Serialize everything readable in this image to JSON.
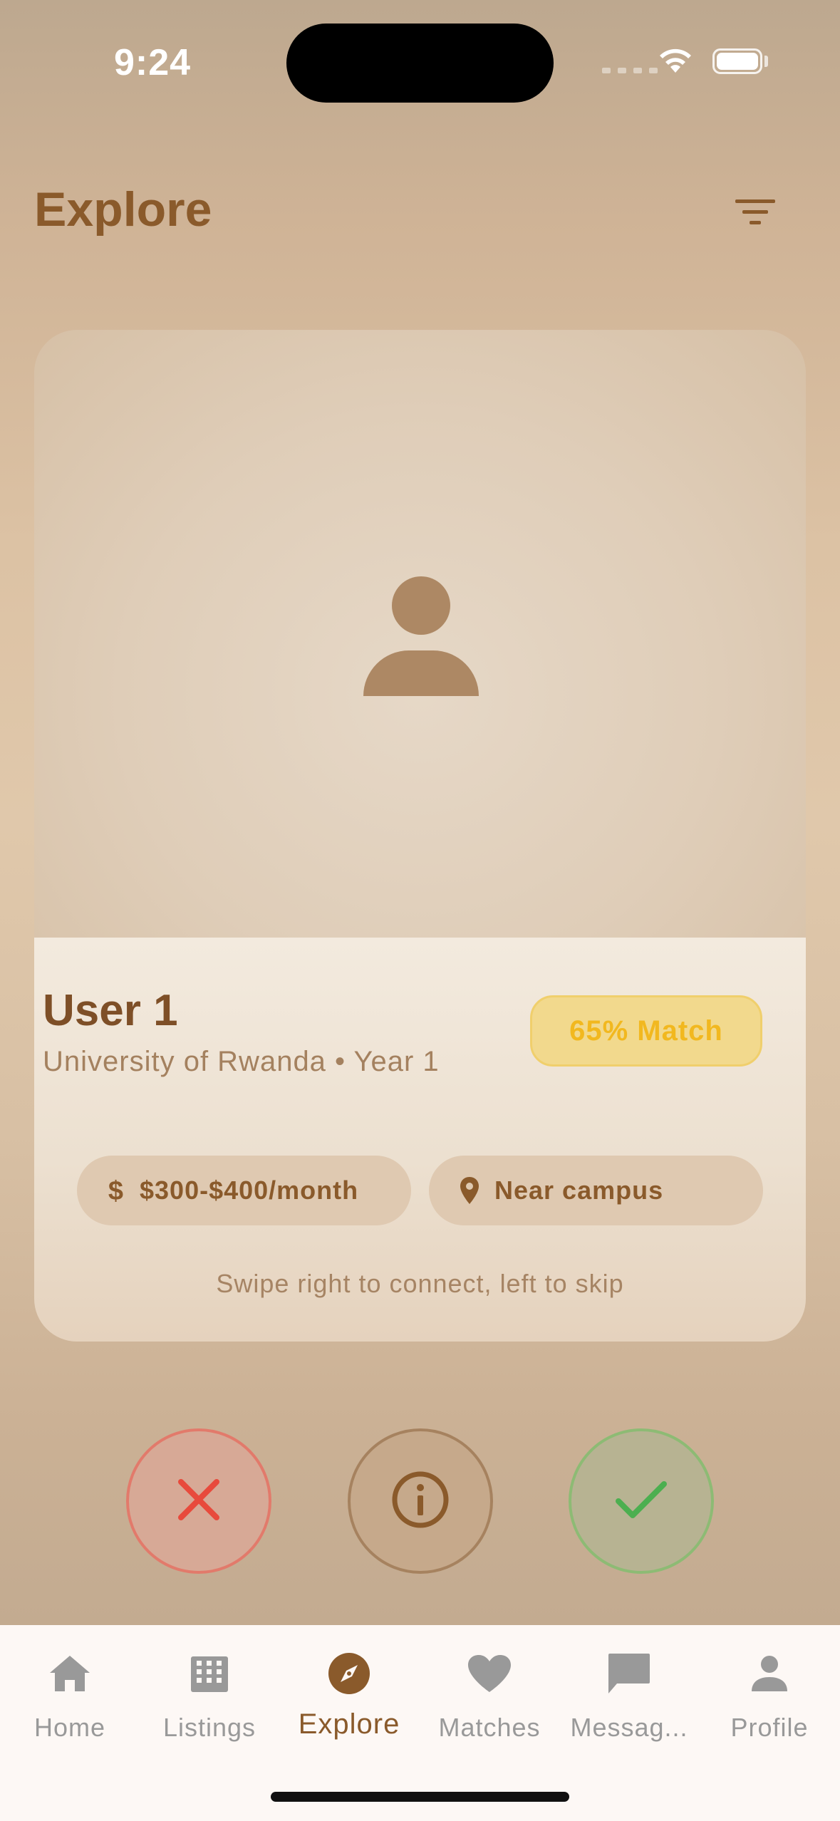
{
  "status_bar": {
    "time": "9:24"
  },
  "header": {
    "title": "Explore",
    "filter_icon": "filter-icon"
  },
  "card": {
    "photo_icon": "person-placeholder-icon",
    "name": "User 1",
    "subtitle": "University of Rwanda • Year 1",
    "match": "65% Match",
    "chips": [
      {
        "icon": "dollar-icon",
        "label": "$300-$400/month"
      },
      {
        "icon": "location-pin-icon",
        "label": "Near campus"
      }
    ],
    "hint": "Swipe right to connect, left to skip"
  },
  "actions": {
    "skip_icon": "close-icon",
    "info_icon": "info-icon",
    "connect_icon": "check-icon"
  },
  "tabs": [
    {
      "label": "Home",
      "icon": "home-icon",
      "active": false
    },
    {
      "label": "Listings",
      "icon": "building-icon",
      "active": false
    },
    {
      "label": "Explore",
      "icon": "compass-icon",
      "active": true
    },
    {
      "label": "Matches",
      "icon": "heart-icon",
      "active": false
    },
    {
      "label": "Messag...",
      "icon": "message-icon",
      "active": false
    },
    {
      "label": "Profile",
      "icon": "person-icon",
      "active": false
    }
  ],
  "colors": {
    "brand": "#8a5a2b",
    "match_badge": "#f2b81f",
    "skip": "#e84a3c",
    "connect": "#4caf50",
    "tab_inactive": "#999999"
  }
}
